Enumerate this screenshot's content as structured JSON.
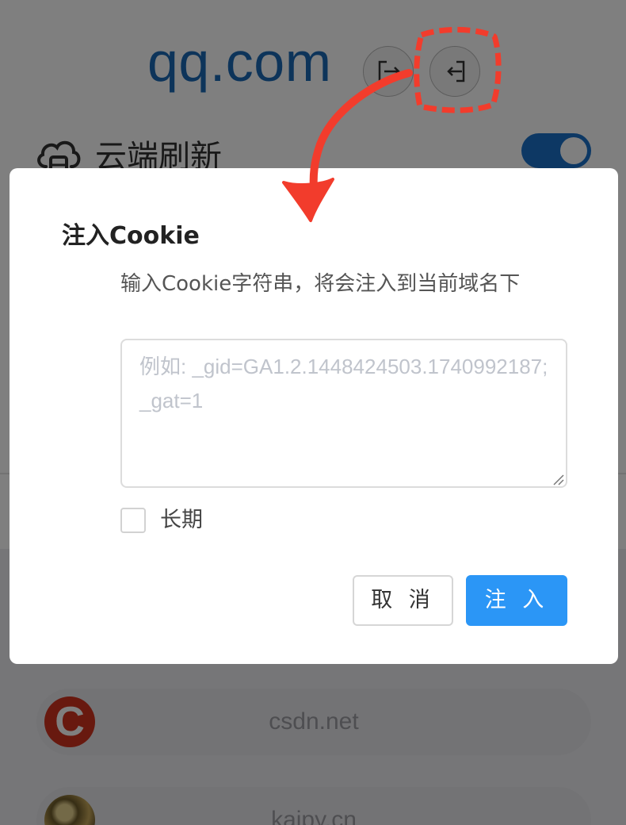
{
  "header": {
    "domain": "qq.com",
    "export_icon": "export-icon",
    "inject_icon": "import-icon"
  },
  "cloud_refresh": {
    "label": "云端刷新",
    "icon": "cloud-lock-icon",
    "enabled": true
  },
  "sites": [
    {
      "name": "csdn.net",
      "logo_letter": "C"
    },
    {
      "name": "kaipy.cn",
      "logo_letter": ""
    }
  ],
  "dialog": {
    "title": "注入Cookie",
    "description": "输入Cookie字符串，将会注入到当前域名下",
    "input_value": "",
    "input_placeholder": "例如: _gid=GA1.2.1448424503.1740992187; _gat=1",
    "long_term_label": "长期",
    "long_term_checked": false,
    "cancel_label": "取 消",
    "inject_label": "注 入"
  },
  "colors": {
    "brand_blue": "#1b69b5",
    "primary_button": "#2b96f6",
    "annotation_red": "#f23c2c"
  }
}
